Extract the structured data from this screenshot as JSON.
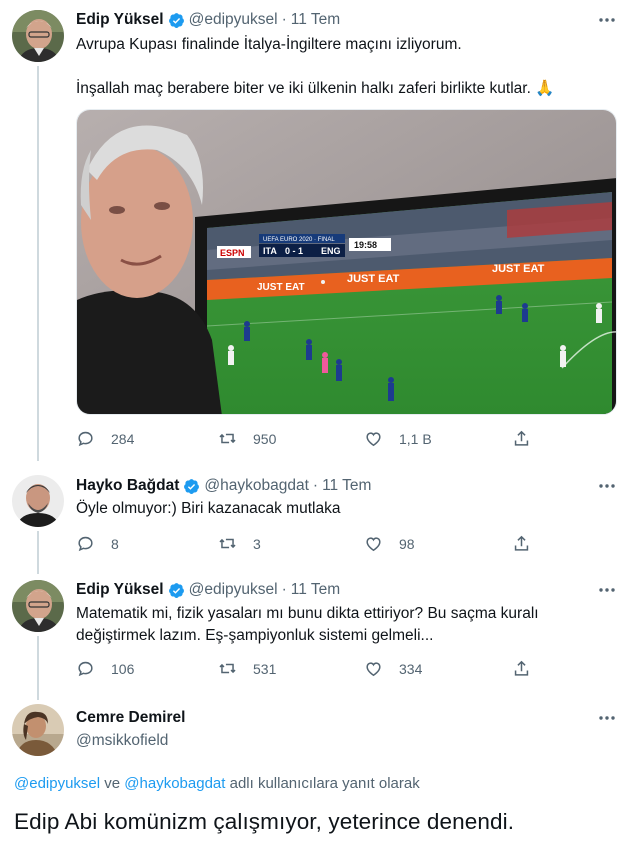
{
  "tweet1": {
    "name": "Edip Yüksel",
    "handle": "@edipyuksel",
    "separator": "·",
    "time": "11 Tem",
    "line1": "Avrupa Kupası finalinde İtalya-İngiltere maçını izliyorum.",
    "line2": "İnşallah maç berabere biter ve iki ülkenin halkı zaferi birlikte kutlar. 🙏",
    "photo": {
      "scorebug_title": "UEFA EURO 2020 · FINAL",
      "team_home": "ITA",
      "score": "0 - 1",
      "team_away": "ENG",
      "clock": "19:58",
      "broadcaster": "ESPN",
      "board_ad": "JUST EAT"
    },
    "stats": {
      "replies": "284",
      "retweets": "950",
      "likes": "1,1 B"
    }
  },
  "tweet2": {
    "name": "Hayko Bağdat",
    "handle": "@haykobagdat",
    "separator": "·",
    "time": "11 Tem",
    "text": "Öyle olmuyor:) Biri kazanacak mutlaka",
    "stats": {
      "replies": "8",
      "retweets": "3",
      "likes": "98"
    }
  },
  "tweet3": {
    "name": "Edip Yüksel",
    "handle": "@edipyuksel",
    "separator": "·",
    "time": "11 Tem",
    "line1": "Matematik mi, fizik yasaları mı bunu dikta ettiriyor? Bu saçma kuralı",
    "line2": "değiştirmek lazım. Eş-şampiyonluk sistemi gelmeli...",
    "stats": {
      "replies": "106",
      "retweets": "531",
      "likes": "334"
    }
  },
  "tweet4": {
    "name": "Cemre Demirel",
    "handle": "@msikkofield",
    "reply_mention1": "@edipyuksel",
    "reply_and": " ve ",
    "reply_mention2": "@haykobagdat",
    "reply_suffix": " adlı kullanıcılara yanıt olarak",
    "text": "Edip Abi komünizm çalışmıyor, yeterince denendi."
  },
  "colors": {
    "accent": "#1d9bf0",
    "muted": "#536471",
    "text": "#0f1419",
    "line": "#cfd9de"
  },
  "icons": [
    "verified-badge-icon",
    "more-icon",
    "reply-icon",
    "retweet-icon",
    "like-icon",
    "share-icon"
  ]
}
